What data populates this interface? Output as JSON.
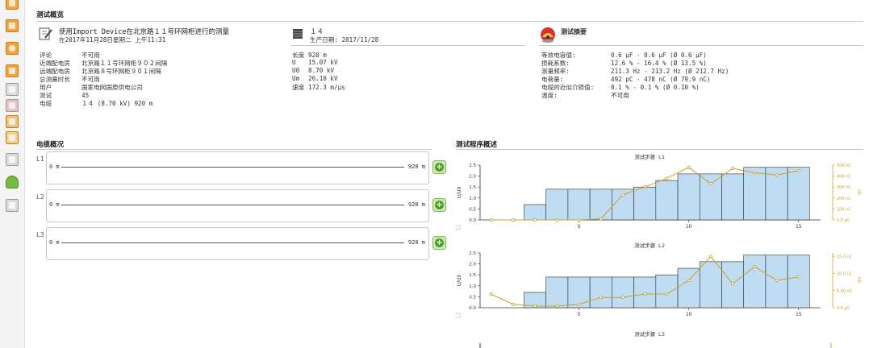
{
  "overview": {
    "heading": "测试概览",
    "test_title": "使用Import Device在北京路１１号环网柜进行的测量",
    "test_date": "在2017年11月28日星期二 上午11:31",
    "details": [
      {
        "label": "评论",
        "value": "不可用"
      },
      {
        "label": "近端配电房",
        "value": "北京路１１号环网柜９０２间隔"
      },
      {
        "label": "远端配电房",
        "value": "北京路８号环网柜９０１间隔"
      },
      {
        "label": "总测量时长",
        "value": "不可用"
      },
      {
        "label": "用户",
        "value": "国家电网国原供电公司"
      },
      {
        "label": "测试",
        "value": "45"
      },
      {
        "label": "电缆",
        "value": "１４ (8.70 kV) 920 m"
      }
    ]
  },
  "cable": {
    "name": "１４",
    "production_date": "生产日期: 2017/11/28",
    "props": [
      {
        "label": "长度",
        "value": "920 m"
      },
      {
        "label": "U",
        "value": "15.07 kV"
      },
      {
        "label": "U0",
        "value": "8.70 kV"
      },
      {
        "label": "Um",
        "value": "26.10 kV"
      },
      {
        "label": "速度",
        "value": "172.3 m/μs"
      }
    ]
  },
  "summary": {
    "heading": "测试摘要",
    "items": [
      {
        "label": "等效电容值:",
        "value": "0.6 μF - 0.6 μF (Ø 0.6 μF)"
      },
      {
        "label": "损耗系数:",
        "value": "12.6 % - 16.4 % (Ø 13.5 %)"
      },
      {
        "label": "测量频率:",
        "value": "211.3 Hz - 213.2 Hz (Ø 212.7 Hz)"
      },
      {
        "label": "电荷量:",
        "value": "492 pC - 478 nC (Ø 79.9 nC)"
      },
      {
        "label": "电缆的近似介损值:",
        "value": "0.1 % - 0.1 % (Ø 0.10 %)"
      },
      {
        "label": "温度:",
        "value": "不可用"
      }
    ]
  },
  "cable_status": {
    "heading": "电缆概况",
    "lines": [
      {
        "label": "L1",
        "start": "0 m",
        "end": "920 m"
      },
      {
        "label": "L2",
        "start": "0 m",
        "end": "920 m"
      },
      {
        "label": "L3",
        "start": "0 m",
        "end": "920 m"
      }
    ]
  },
  "procedure": {
    "heading": "测试程序概述"
  },
  "colors": {
    "bar_fill": "#bfdcf2",
    "bar_stroke": "#2d2d2d",
    "line": "#c9a227",
    "accent_green": "#4ba228",
    "toolbar_orange": "#f0a53a"
  },
  "toolbar_icons": [
    "report-icon",
    "monitor-icon",
    "search-icon",
    "chart-icon",
    "table-icon",
    "grid-icon",
    "cabinet-icon",
    "cube-icon",
    "tree-icon",
    "database-icon",
    "list-icon"
  ],
  "chart_data": [
    {
      "type": "bar",
      "title": "测试步骤 L1",
      "ylabel": "U/U0",
      "y2label": "nC",
      "ylim": [
        0,
        2.5
      ],
      "yticks": [
        "0.0",
        "0.5",
        "1.0",
        "1.5",
        "2.0",
        "2.5"
      ],
      "y2lim": [
        0,
        500
      ],
      "y2ticks": [
        "0.0 pC",
        "100 nC",
        "200 nC",
        "300 nC",
        "400 nC",
        "500 nC"
      ],
      "xticks": [
        5,
        10,
        15
      ],
      "x": [
        1,
        2,
        3,
        4,
        5,
        6,
        7,
        8,
        9,
        10,
        11,
        12,
        13,
        14,
        15
      ],
      "bars": [
        0,
        0,
        0.7,
        1.4,
        1.4,
        1.4,
        1.4,
        1.5,
        1.8,
        2.1,
        2.1,
        2.1,
        2.4,
        2.4,
        2.4
      ],
      "line": [
        0,
        0,
        0,
        0,
        0,
        10,
        230,
        300,
        380,
        480,
        330,
        470,
        430,
        410,
        450
      ]
    },
    {
      "type": "bar",
      "title": "测试步骤 L2",
      "ylabel": "U/U0",
      "y2label": "nC",
      "ylim": [
        0,
        2.5
      ],
      "yticks": [
        "0.0",
        "0.5",
        "1.0",
        "1.5",
        "2.0",
        "2.5"
      ],
      "y2lim": [
        0,
        16
      ],
      "y2ticks": [
        "0.0 pC",
        "5.00 nC",
        "10.0 nC",
        "15.0 nC"
      ],
      "xticks": [
        5,
        10,
        15
      ],
      "x": [
        1,
        2,
        3,
        4,
        5,
        6,
        7,
        8,
        9,
        10,
        11,
        12,
        13,
        14,
        15
      ],
      "bars": [
        0,
        0,
        0.7,
        1.4,
        1.4,
        1.4,
        1.4,
        1.4,
        1.5,
        1.8,
        2.1,
        2.1,
        2.4,
        2.4,
        2.4
      ],
      "line": [
        4,
        1,
        0.5,
        0.5,
        1,
        3,
        3,
        4,
        4,
        8,
        15,
        7,
        12,
        8,
        9
      ]
    }
  ],
  "chart3_title": "测试步骤 L3"
}
